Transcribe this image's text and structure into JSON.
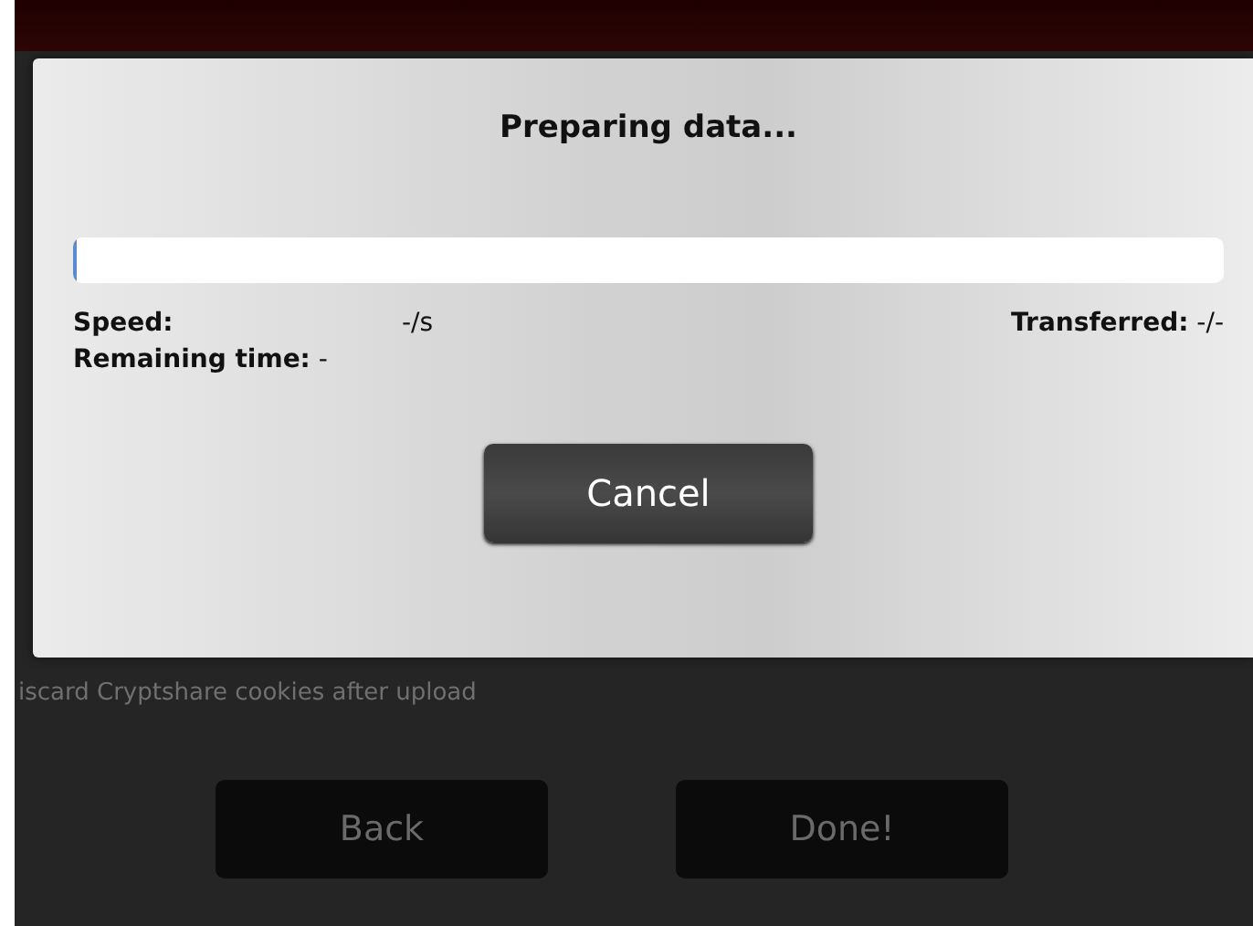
{
  "dialog": {
    "title": "Preparing data...",
    "progress": {
      "level": 0
    },
    "speed": {
      "label": "Speed:",
      "value": "-/s"
    },
    "transferred": {
      "label": "Transferred:",
      "value": "-/-"
    },
    "remaining": {
      "label": "Remaining time:",
      "value": "-"
    },
    "cancel_button": "Cancel"
  },
  "background": {
    "option_text": "iscard Cryptshare cookies after upload",
    "buttons": [
      "Back",
      "Done!"
    ]
  }
}
